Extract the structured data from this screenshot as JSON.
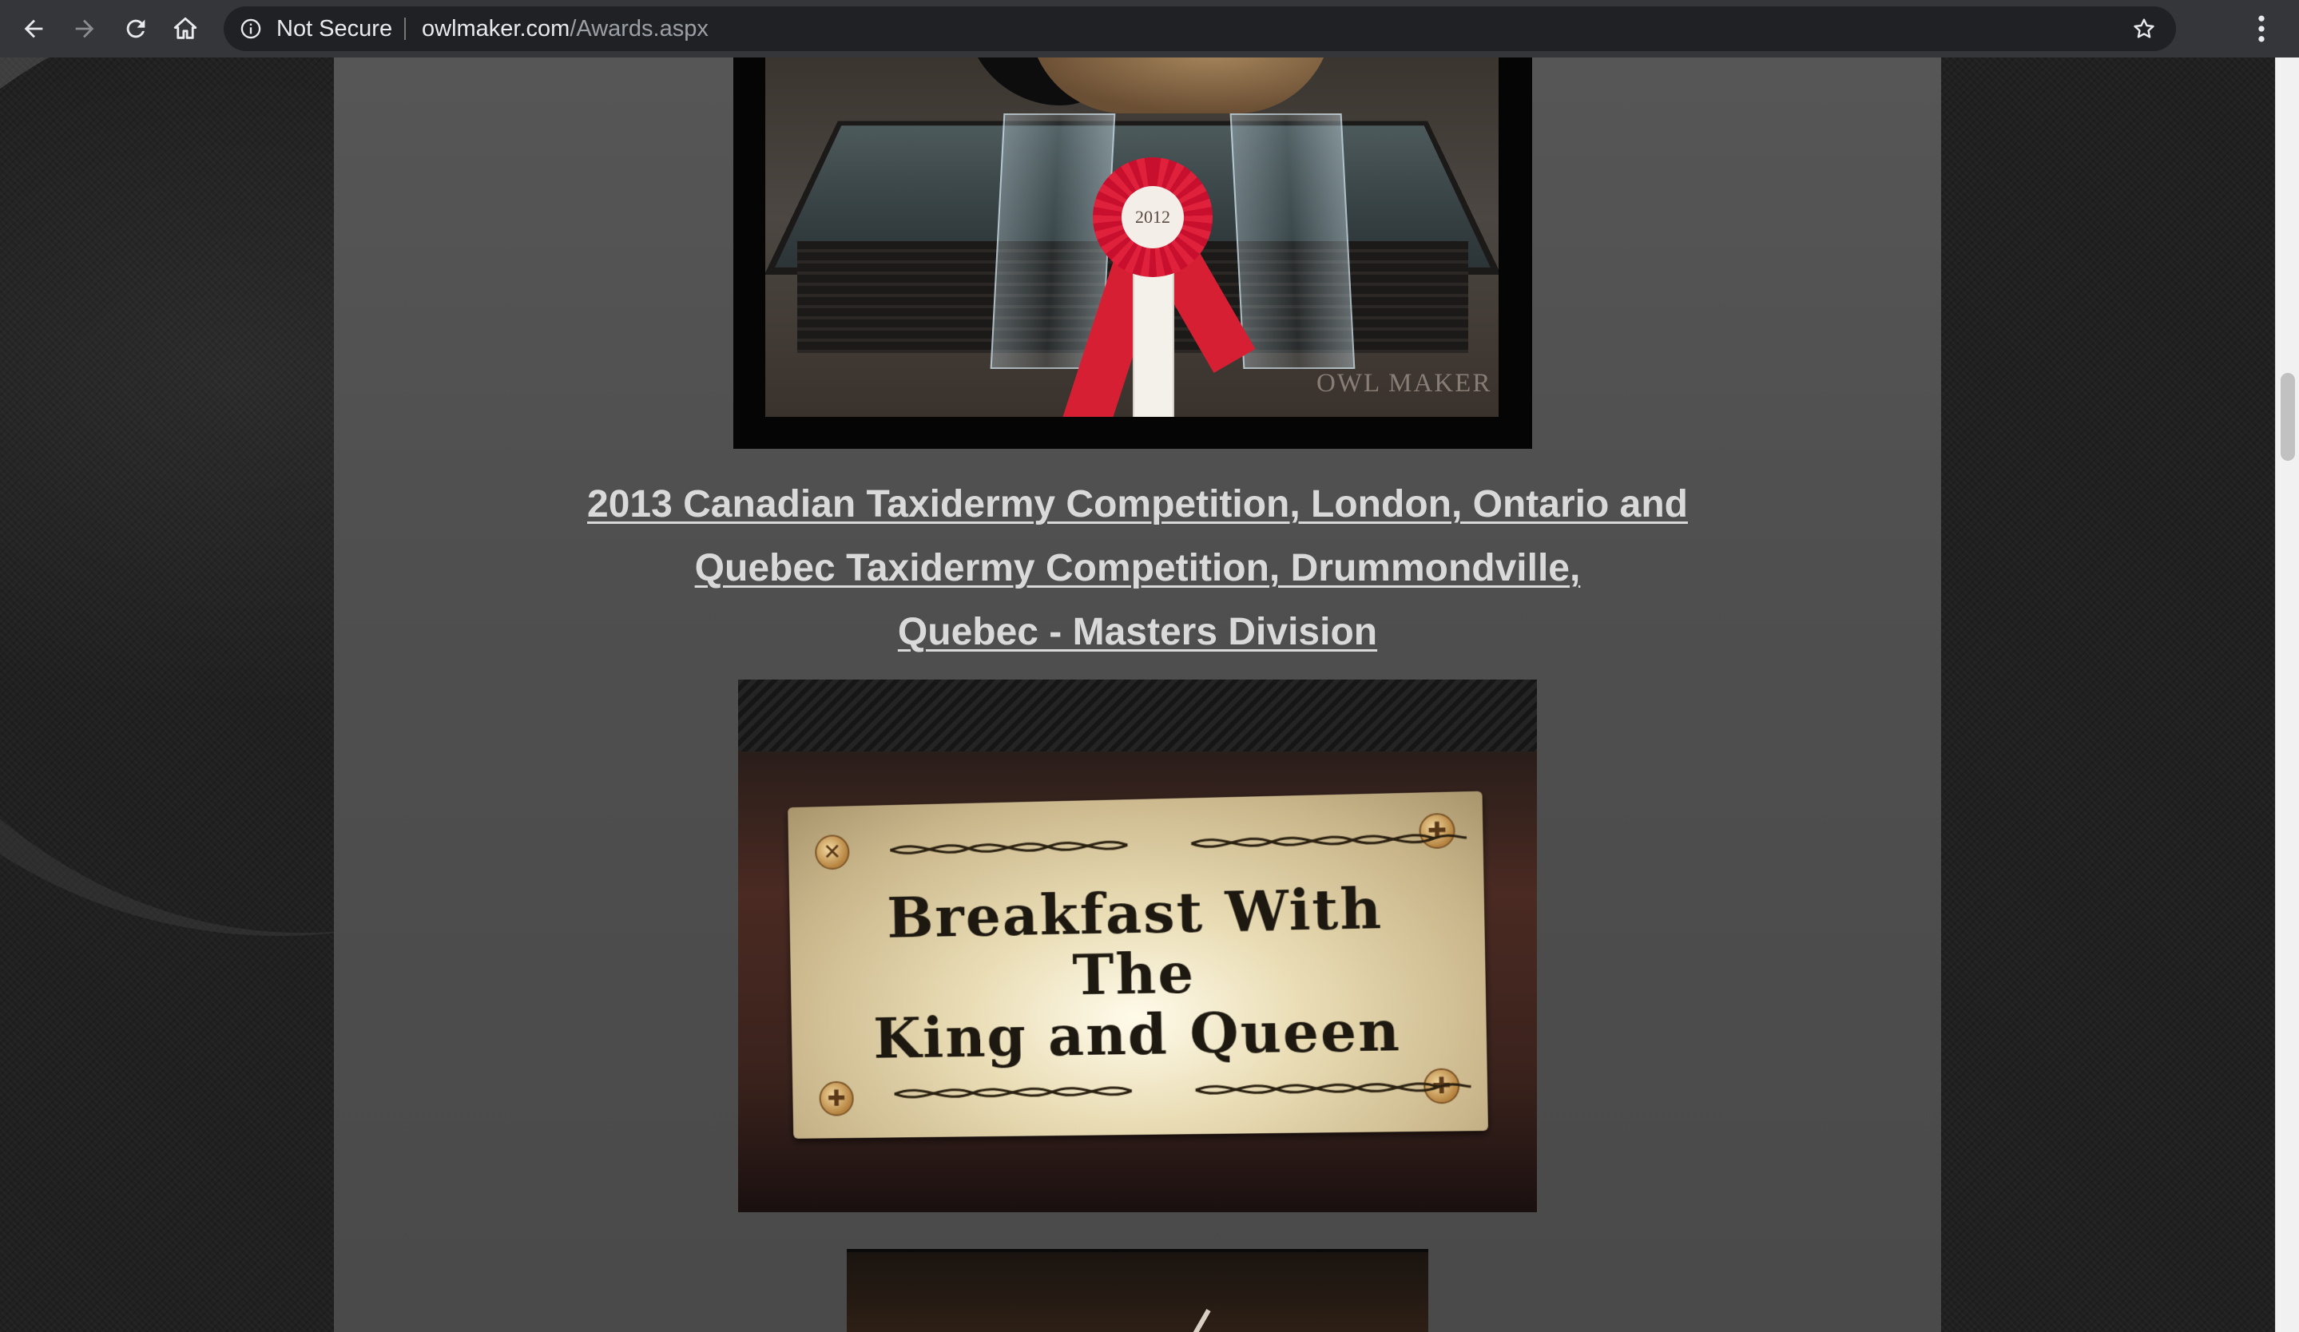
{
  "browser": {
    "security_label": "Not Secure",
    "url_host": "owlmaker.com",
    "url_path": "/Awards.aspx",
    "icons": [
      "back-icon",
      "forward-icon",
      "reload-icon",
      "home-icon",
      "info-icon",
      "star-icon",
      "menu-icon"
    ]
  },
  "page": {
    "trophy_image": {
      "rosette_year": "2012",
      "watermark": "OWL MAKER"
    },
    "award_heading": {
      "line1": "2013 Canadian Taxidermy Competition, London, Ontario and",
      "line2": "Quebec Taxidermy Competition, Drummondville,",
      "line3": "Quebec - Masters Division"
    },
    "plaque_image": {
      "line1": "Breakfast With",
      "line2": "The",
      "line3": "King and Queen"
    }
  },
  "colors": {
    "chrome": "#35363a",
    "omnibox": "#202124",
    "content_panel": "#4f4f4f",
    "link": "#d9d9d9"
  }
}
